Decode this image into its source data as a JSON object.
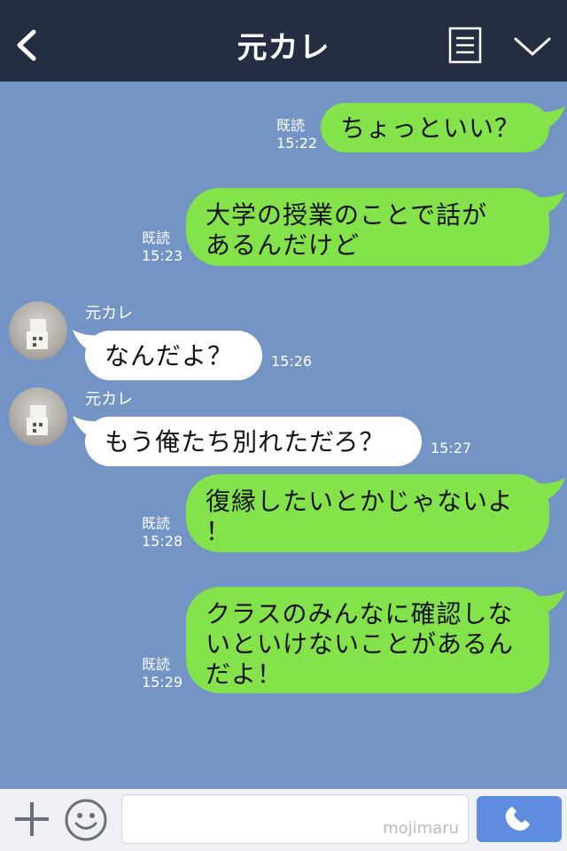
{
  "header": {
    "title": "元カレ"
  },
  "contact": {
    "name": "元カレ"
  },
  "messages": [
    {
      "direction": "out",
      "text": "ちょっといい？",
      "read": "既読",
      "time": "15:22"
    },
    {
      "direction": "out",
      "text": "大学の授業のことで話が\nあるんだけど",
      "read": "既読",
      "time": "15:23"
    },
    {
      "direction": "in",
      "sender": "元カレ",
      "text": "なんだよ？",
      "time": "15:26"
    },
    {
      "direction": "in",
      "sender": "元カレ",
      "text": "もう俺たち別れただろ？",
      "time": "15:27"
    },
    {
      "direction": "out",
      "text": "復縁したいとかじゃないよ\n！",
      "read": "既読",
      "time": "15:28"
    },
    {
      "direction": "out",
      "text": "クラスのみんなに確認しな\nいといけないことがあるん\nだよ！",
      "read": "既読",
      "time": "15:29"
    }
  ],
  "footer": {
    "watermark": "mojimaru"
  },
  "icons": [
    "back-icon",
    "menu-icon",
    "chevron-down-icon",
    "plus-icon",
    "emoji-icon",
    "phone-icon"
  ],
  "colors": {
    "header": "#242d42",
    "background": "#7394c4",
    "bubble_out": "#84e24a",
    "bubble_in": "#ffffff",
    "call": "#5e8de0"
  }
}
